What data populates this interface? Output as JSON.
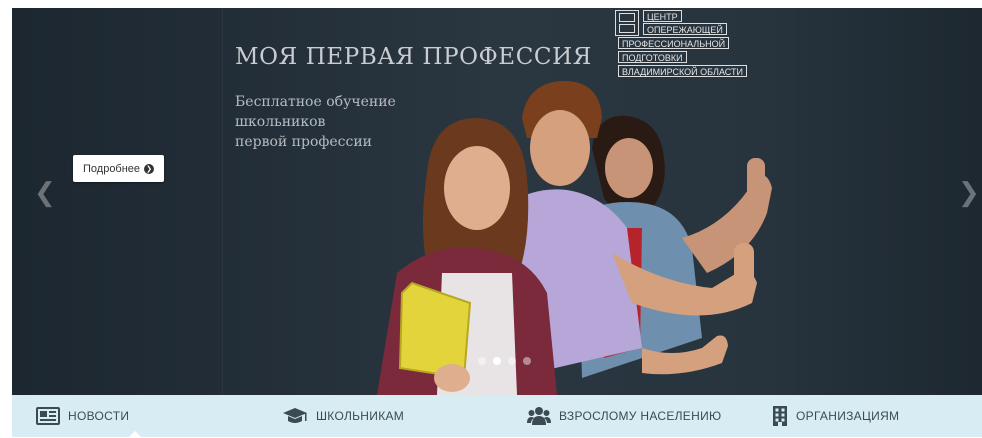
{
  "slider": {
    "title": "МОЯ ПЕРВАЯ ПРОФЕССИЯ",
    "subtitle_lines": [
      "Бесплатное обучение",
      "школьников",
      "первой профессии"
    ],
    "button_label": "Подробнее",
    "logo_lines": [
      "ЦЕНТР",
      "ОПЕРЕЖАЮЩЕЙ",
      "ПРОФЕССИОНАЛЬНОЙ",
      "ПОДГОТОВКИ",
      "ВЛАДИМИРСКОЙ ОБЛАСТИ"
    ],
    "active_slide": 2,
    "slide_count": 4,
    "prev_icon": "chevron-left-icon",
    "next_icon": "chevron-right-icon"
  },
  "nav": {
    "items": [
      {
        "label": "НОВОСТИ",
        "icon": "newspaper-icon",
        "active": true
      },
      {
        "label": "ШКОЛЬНИКАМ",
        "icon": "graduation-cap-icon",
        "active": false
      },
      {
        "label": "ВЗРОСЛОМУ НАСЕЛЕНИЮ",
        "icon": "users-icon",
        "active": false
      },
      {
        "label": "ОРГАНИЗАЦИЯМ",
        "icon": "building-icon",
        "active": false
      }
    ]
  },
  "colors": {
    "slider_bg": "#26313b",
    "nav_bg": "#d8ecf4",
    "nav_text": "#3c4a54"
  }
}
